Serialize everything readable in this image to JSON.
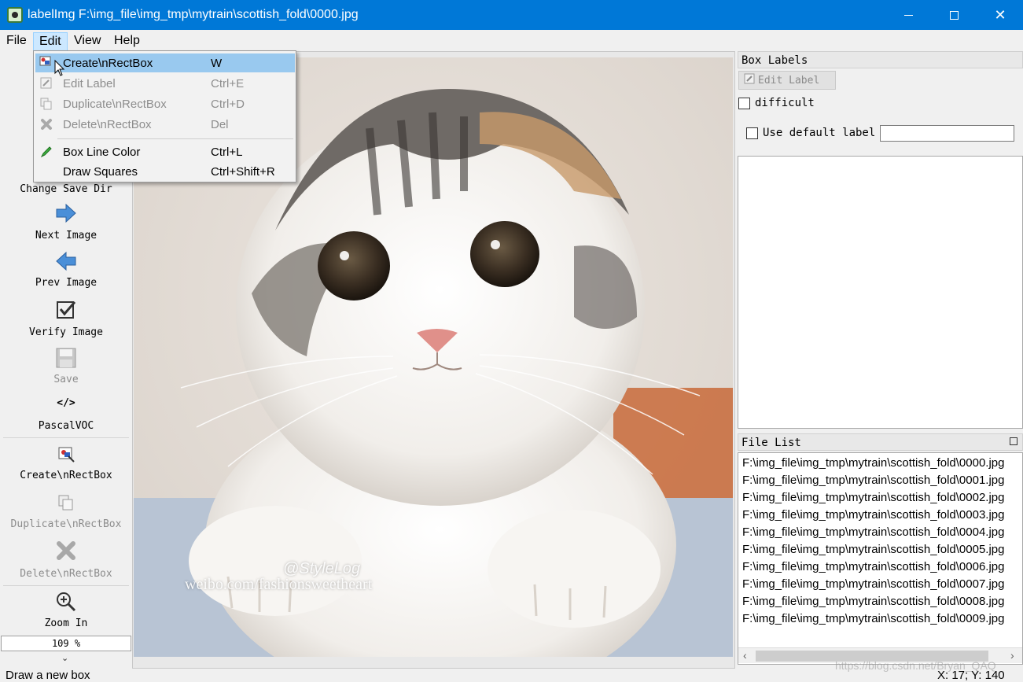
{
  "window": {
    "title": "labelImg F:\\img_file\\img_tmp\\mytrain\\scottish_fold\\0000.jpg",
    "accent": "#0078d7"
  },
  "menubar": {
    "file": "File",
    "edit": "Edit",
    "view": "View",
    "help": "Help"
  },
  "edit_menu": {
    "items": [
      {
        "label": "Create\\nRectBox",
        "shortcut": "W",
        "icon": "create-rectbox-icon",
        "state": "highlighted"
      },
      {
        "label": "Edit Label",
        "shortcut": "Ctrl+E",
        "icon": "edit-label-icon",
        "state": "disabled"
      },
      {
        "label": "Duplicate\\nRectBox",
        "shortcut": "Ctrl+D",
        "icon": "duplicate-icon",
        "state": "disabled"
      },
      {
        "label": "Delete\\nRectBox",
        "shortcut": "Del",
        "icon": "delete-icon",
        "state": "disabled"
      },
      {
        "label": "Box Line Color",
        "shortcut": "Ctrl+L",
        "icon": "pencil-icon",
        "state": "enabled"
      },
      {
        "label": "Draw Squares",
        "shortcut": "Ctrl+Shift+R",
        "icon": "",
        "state": "enabled"
      }
    ]
  },
  "toolbar": {
    "change_save_dir": "Change Save Dir",
    "next_image": "Next Image",
    "prev_image": "Prev Image",
    "verify_image": "Verify Image",
    "save": "Save",
    "format_icon_text": "</>",
    "format": "PascalVOC",
    "create_rectbox": "Create\\nRectBox",
    "duplicate_rectbox": "Duplicate\\nRectBox",
    "delete_rectbox": "Delete\\nRectBox",
    "zoom_in": "Zoom In",
    "zoom_value": "109 %"
  },
  "canvas": {
    "watermark_line1": "@StyleLog",
    "watermark_line2": "weibo.com/fashionsweetheart"
  },
  "box_labels": {
    "title": "Box Labels",
    "edit_label_button": "Edit Label",
    "difficult": "difficult",
    "use_default_label": "Use default label",
    "default_label_value": ""
  },
  "file_list": {
    "title": "File List",
    "items": [
      "F:\\img_file\\img_tmp\\mytrain\\scottish_fold\\0000.jpg",
      "F:\\img_file\\img_tmp\\mytrain\\scottish_fold\\0001.jpg",
      "F:\\img_file\\img_tmp\\mytrain\\scottish_fold\\0002.jpg",
      "F:\\img_file\\img_tmp\\mytrain\\scottish_fold\\0003.jpg",
      "F:\\img_file\\img_tmp\\mytrain\\scottish_fold\\0004.jpg",
      "F:\\img_file\\img_tmp\\mytrain\\scottish_fold\\0005.jpg",
      "F:\\img_file\\img_tmp\\mytrain\\scottish_fold\\0006.jpg",
      "F:\\img_file\\img_tmp\\mytrain\\scottish_fold\\0007.jpg",
      "F:\\img_file\\img_tmp\\mytrain\\scottish_fold\\0008.jpg",
      "F:\\img_file\\img_tmp\\mytrain\\scottish_fold\\0009.jpg"
    ]
  },
  "status": {
    "message": "Draw a new box",
    "coords": "X: 17; Y: 140"
  },
  "page_watermark": "https://blog.csdn.net/Bryan_QAQ"
}
